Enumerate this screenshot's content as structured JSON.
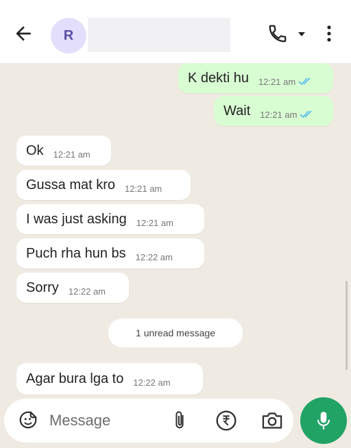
{
  "header": {
    "contact_initial": "R",
    "icons": [
      "back-arrow-icon",
      "call-icon",
      "dropdown-caret-icon",
      "more-vert-icon"
    ]
  },
  "messages": [
    {
      "direction": "out",
      "text": "K dekti hu",
      "time": "12:21 am",
      "status": "read"
    },
    {
      "direction": "out",
      "text": "Wait",
      "time": "12:21 am",
      "status": "read"
    },
    {
      "direction": "in",
      "text": "Ok",
      "time": "12:21 am"
    },
    {
      "direction": "in",
      "text": "Gussa mat kro",
      "time": "12:21 am"
    },
    {
      "direction": "in",
      "text": "I was just asking",
      "time": "12:21 am"
    },
    {
      "direction": "in",
      "text": "Puch rha hun bs",
      "time": "12:22 am"
    },
    {
      "direction": "in",
      "text": "Sorry",
      "time": "12:22 am"
    },
    {
      "direction": "in",
      "text": "Agar bura lga to",
      "time": "12:22 am"
    }
  ],
  "unread_label": "1 unread message",
  "compose": {
    "placeholder": "Message",
    "icons": [
      "emoji-sticker-icon",
      "attach-icon",
      "rupee-payment-icon",
      "camera-icon",
      "mic-icon"
    ]
  },
  "colors": {
    "outgoing_bubble": "#d9fdd3",
    "incoming_bubble": "#ffffff",
    "chat_background": "#efeae2",
    "read_ticks": "#53bdeb",
    "mic_button": "#21a366",
    "avatar_bg": "#e2defb"
  }
}
